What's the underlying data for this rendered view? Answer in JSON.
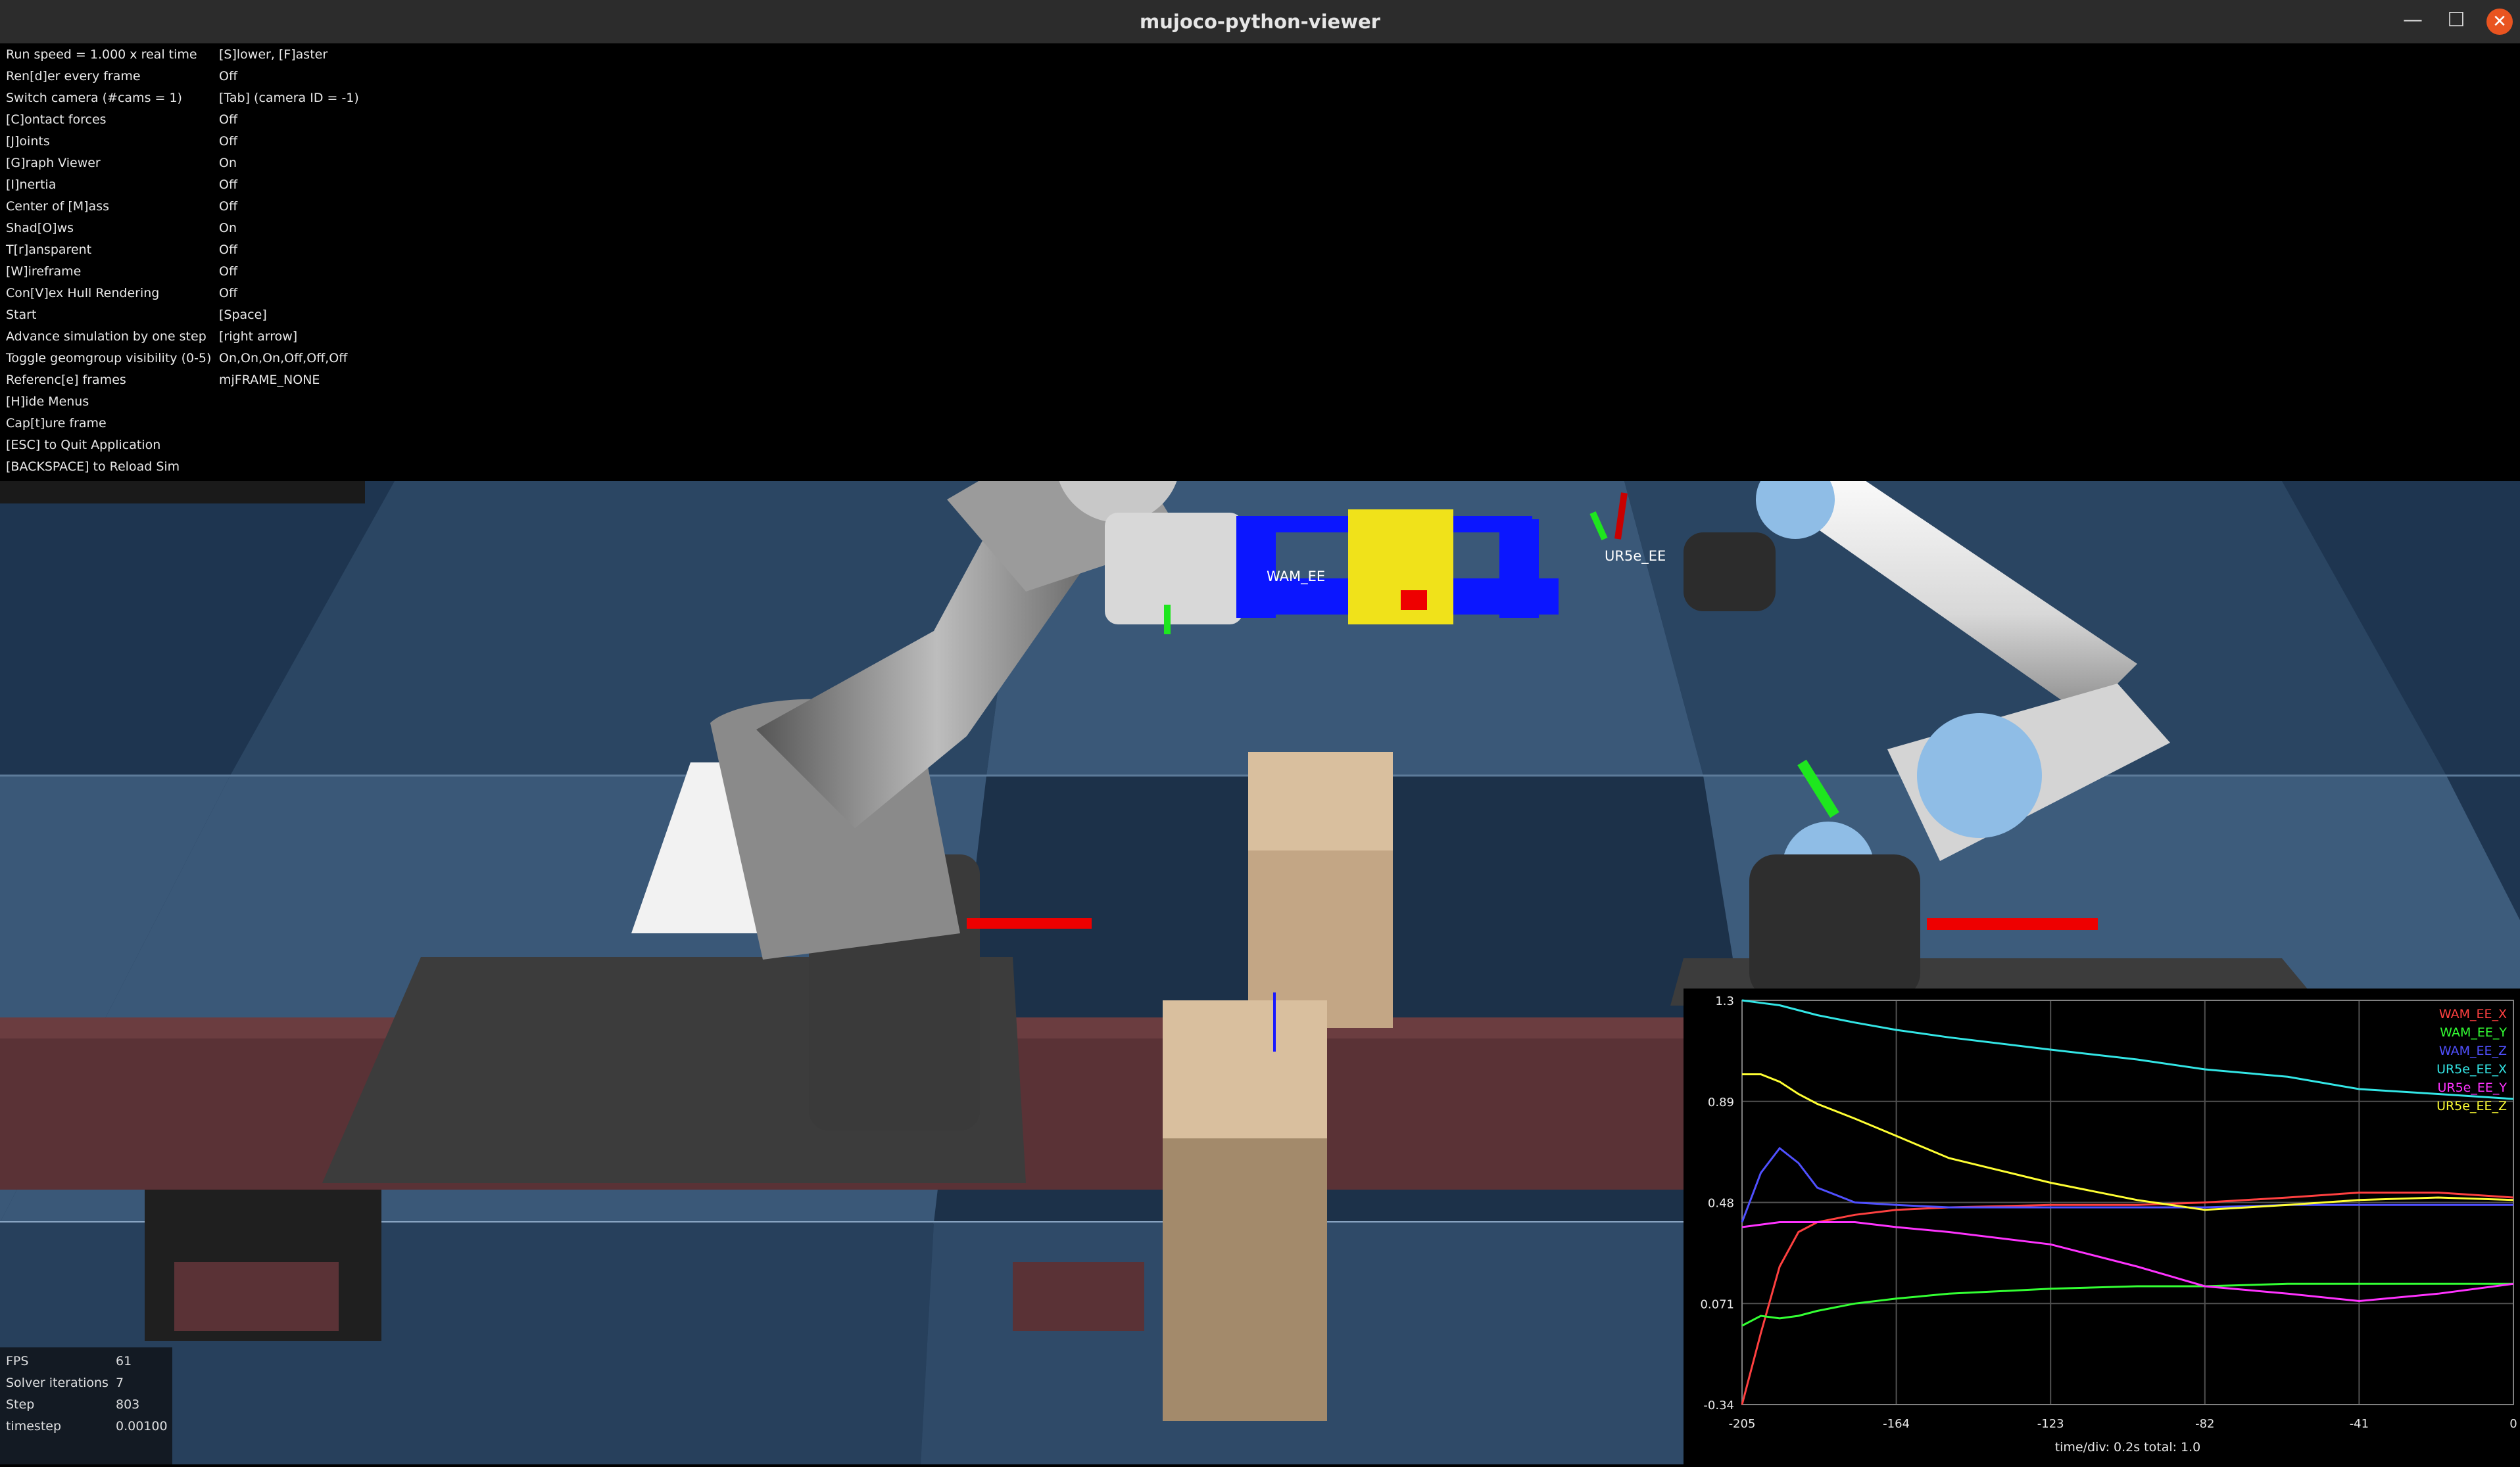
{
  "window": {
    "title": "mujoco-python-viewer",
    "minimize_icon": "—",
    "maximize_icon": "☐",
    "close_icon": "✕"
  },
  "menu": {
    "items": [
      {
        "label": "Run speed = 1.000 x real time",
        "value": "[S]lower, [F]aster"
      },
      {
        "label": "Ren[d]er every frame",
        "value": "Off"
      },
      {
        "label": "Switch camera (#cams = 1)",
        "value": "[Tab] (camera ID = -1)"
      },
      {
        "label": "[C]ontact forces",
        "value": "Off"
      },
      {
        "label": "[J]oints",
        "value": "Off"
      },
      {
        "label": "[G]raph Viewer",
        "value": "On"
      },
      {
        "label": "[I]nertia",
        "value": "Off"
      },
      {
        "label": "Center of [M]ass",
        "value": "Off"
      },
      {
        "label": "Shad[O]ws",
        "value": "On"
      },
      {
        "label": "T[r]ansparent",
        "value": "Off"
      },
      {
        "label": "[W]ireframe",
        "value": "Off"
      },
      {
        "label": "Con[V]ex Hull Rendering",
        "value": "Off"
      },
      {
        "label": "Start",
        "value": "[Space]"
      },
      {
        "label": "Advance simulation by one step",
        "value": "[right arrow]"
      },
      {
        "label": "Toggle geomgroup visibility (0-5)",
        "value": "On,On,On,Off,Off,Off"
      },
      {
        "label": "Referenc[e] frames",
        "value": "mjFRAME_NONE"
      },
      {
        "label": "[H]ide Menus",
        "value": ""
      },
      {
        "label": "Cap[t]ure frame",
        "value": ""
      },
      {
        "label": "[ESC] to Quit Application",
        "value": ""
      },
      {
        "label": "[BACKSPACE] to Reload Sim",
        "value": ""
      }
    ]
  },
  "scene": {
    "labels": {
      "wam_ee": "WAM_EE",
      "ur5e_ee": "UR5e_EE"
    },
    "colors": {
      "floor_dark": "#1e3550",
      "floor_light": "#3a5878",
      "rail": "#5a3236",
      "platform": "#3c3c3c",
      "box": "#d9bf9e",
      "handle_blue": "#0b16ff",
      "block_yellow": "#f0e21a",
      "robot_grey": "#7d7d7d",
      "ur_blue": "#8fbde6"
    }
  },
  "stats": {
    "rows": [
      {
        "label": "FPS",
        "value": "61"
      },
      {
        "label": "Solver iterations",
        "value": "7"
      },
      {
        "label": "Step",
        "value": "803"
      },
      {
        "label": "timestep",
        "value": "0.00100"
      }
    ]
  },
  "graph": {
    "footer": "time/div: 0.2s total: 1.0",
    "y_ticks": [
      "1.3",
      "0.89",
      "0.48",
      "0.071",
      "-0.34"
    ],
    "x_ticks": [
      "-205",
      "-164",
      "-123",
      "-82",
      "-41",
      "0"
    ]
  },
  "chart_data": {
    "type": "line",
    "xlabel": "time/div: 0.2s total: 1.0",
    "xlim": [
      -205,
      0
    ],
    "ylim": [
      -0.34,
      1.3
    ],
    "x": [
      -205,
      -200,
      -195,
      -190,
      -185,
      -175,
      -164,
      -150,
      -123,
      -100,
      -82,
      -60,
      -41,
      -20,
      0
    ],
    "series": [
      {
        "name": "WAM_EE_X",
        "color": "#ff4040",
        "values": [
          -0.34,
          -0.05,
          0.22,
          0.36,
          0.4,
          0.43,
          0.45,
          0.46,
          0.47,
          0.47,
          0.48,
          0.5,
          0.52,
          0.52,
          0.5
        ]
      },
      {
        "name": "WAM_EE_Y",
        "color": "#33ff33",
        "values": [
          -0.02,
          0.02,
          0.01,
          0.02,
          0.04,
          0.07,
          0.09,
          0.11,
          0.13,
          0.14,
          0.14,
          0.15,
          0.15,
          0.15,
          0.15
        ]
      },
      {
        "name": "WAM_EE_Z",
        "color": "#5050ff",
        "values": [
          0.4,
          0.6,
          0.7,
          0.64,
          0.54,
          0.48,
          0.47,
          0.46,
          0.46,
          0.46,
          0.46,
          0.47,
          0.47,
          0.47,
          0.47
        ]
      },
      {
        "name": "UR5e_EE_X",
        "color": "#33e6e6",
        "values": [
          1.3,
          1.29,
          1.28,
          1.26,
          1.24,
          1.21,
          1.18,
          1.15,
          1.1,
          1.06,
          1.02,
          0.99,
          0.94,
          0.92,
          0.9
        ]
      },
      {
        "name": "UR5e_EE_Y",
        "color": "#ff33ff",
        "values": [
          0.38,
          0.39,
          0.4,
          0.4,
          0.4,
          0.4,
          0.38,
          0.36,
          0.31,
          0.22,
          0.14,
          0.11,
          0.08,
          0.11,
          0.15
        ]
      },
      {
        "name": "UR5e_EE_Z",
        "color": "#ffff33",
        "values": [
          1.0,
          1.0,
          0.97,
          0.92,
          0.88,
          0.82,
          0.75,
          0.66,
          0.56,
          0.49,
          0.45,
          0.47,
          0.49,
          0.5,
          0.49
        ]
      }
    ]
  }
}
